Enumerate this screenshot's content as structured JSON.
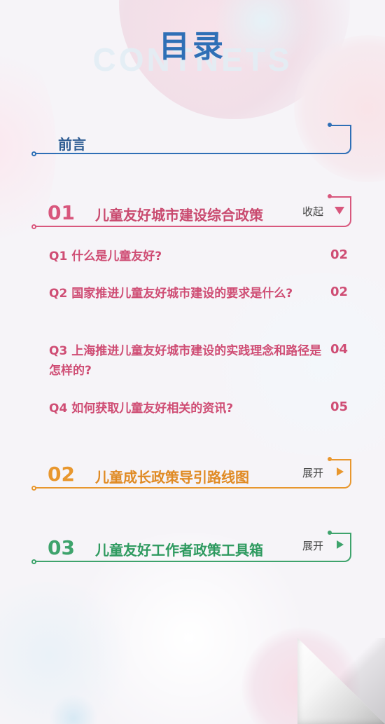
{
  "header": {
    "title": "目录",
    "watermark": "CONTNETS"
  },
  "preface": {
    "label": "前言"
  },
  "sections": [
    {
      "num": "01",
      "title": "儿童友好城市建设综合政策",
      "toggle": "收起",
      "color": "#d8577d"
    },
    {
      "num": "02",
      "title": "儿童成长政策导引路线图",
      "toggle": "展开",
      "color": "#e8972e"
    },
    {
      "num": "03",
      "title": "儿童友好工作者政策工具箱",
      "toggle": "展开",
      "color": "#3ea36c"
    }
  ],
  "questions": [
    {
      "text": "Q1 什么是儿童友好?",
      "page": "02"
    },
    {
      "text": "Q2 国家推进儿童友好城市建设的要求是什么?",
      "page": "02"
    },
    {
      "text": "Q3 上海推进儿童友好城市建设的实践理念和路径是怎样的?",
      "page": "04"
    },
    {
      "text": "Q4 如何获取儿童友好相关的资讯?",
      "page": "05"
    }
  ],
  "icons": {
    "collapse": "triangle-down-icon",
    "expand": "triangle-right-icon"
  }
}
